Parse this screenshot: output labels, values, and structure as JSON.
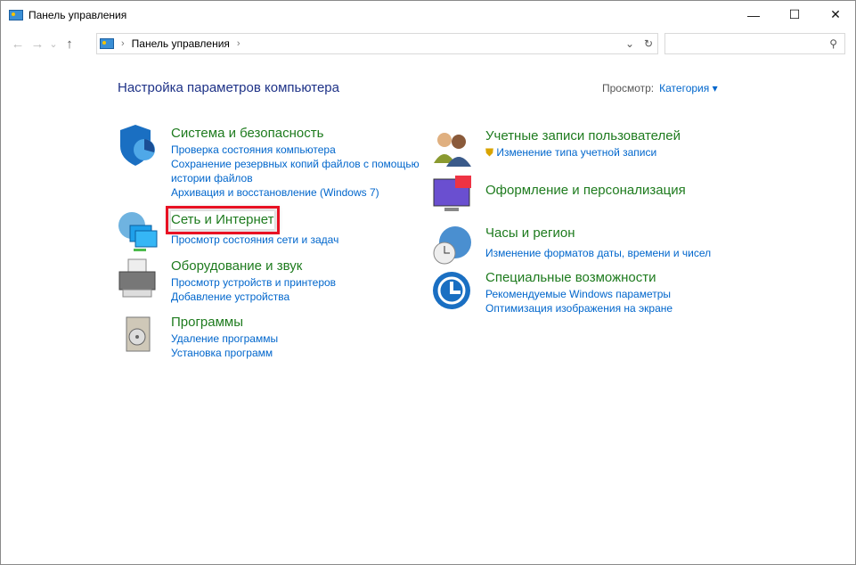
{
  "window": {
    "title": "Панель управления",
    "minimize": "—",
    "maximize": "☐",
    "close": "✕"
  },
  "nav": {
    "back": "←",
    "forward": "→",
    "recent": "⌄",
    "up": "↑",
    "breadcrumb": "Панель управления",
    "dropdown": "⌄",
    "refresh": "↻",
    "search_placeholder": "",
    "search_icon": "⚲"
  },
  "main": {
    "heading": "Настройка параметров компьютера",
    "view_label": "Просмотр:",
    "view_value": "Категория ▾"
  },
  "left": [
    {
      "title": "Система и безопасность",
      "links": [
        "Проверка состояния компьютера",
        "Сохранение резервных копий файлов с помощью истории файлов",
        "Архивация и восстановление (Windows 7)"
      ]
    },
    {
      "title": "Сеть и Интернет",
      "links": [
        "Просмотр состояния сети и задач"
      ]
    },
    {
      "title": "Оборудование и звук",
      "links": [
        "Просмотр устройств и принтеров",
        "Добавление устройства"
      ]
    },
    {
      "title": "Программы",
      "links": [
        "Удаление программы",
        "Установка программ"
      ]
    }
  ],
  "right": [
    {
      "title": "Учетные записи пользователей",
      "links": [
        "Изменение типа учетной записи"
      ]
    },
    {
      "title": "Оформление и персонализация",
      "links": []
    },
    {
      "title": "Часы и регион",
      "links": [
        "Изменение форматов даты, времени и чисел"
      ]
    },
    {
      "title": "Специальные возможности",
      "links": [
        "Рекомендуемые Windows параметры",
        "Оптимизация изображения на экране"
      ]
    }
  ]
}
